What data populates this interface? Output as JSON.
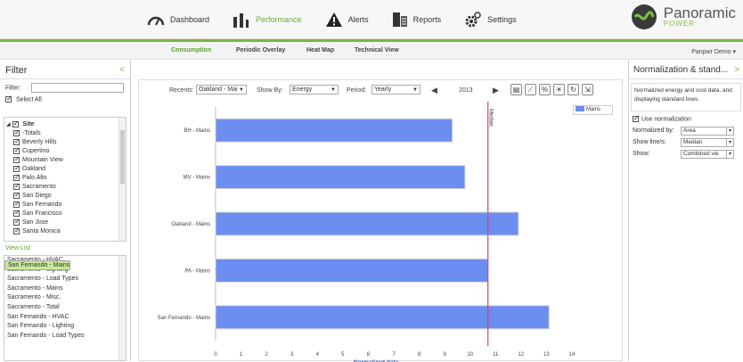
{
  "nav": {
    "items": [
      {
        "label": "Dashboard",
        "icon": "gauge-icon"
      },
      {
        "label": "Performance",
        "icon": "bars-icon",
        "active": true
      },
      {
        "label": "Alerts",
        "icon": "warning-icon"
      },
      {
        "label": "Reports",
        "icon": "reports-icon"
      },
      {
        "label": "Settings",
        "icon": "gear-icon"
      }
    ],
    "brand": "Panoramic",
    "brand_sub": "POWER"
  },
  "subnav": {
    "tabs": [
      "Consumption",
      "Periodic Overlay",
      "Heat Map",
      "Technical View"
    ],
    "user": "Panpwr Demo ▾"
  },
  "filter": {
    "title": "Filter",
    "collapse": "<",
    "filter_label": "Filter:",
    "select_all": "Select All",
    "root": "Site",
    "sites": [
      "-Totals",
      "Beverly Hills",
      "Cupertino",
      "Mountain View",
      "Oakland",
      "Palo Alto",
      "Sacramento",
      "San Diego",
      "San Fernando",
      "San Francisco",
      "San Jose",
      "Santa Monica"
    ],
    "view_list": "View List",
    "list": [
      "Sacramento - HVAC",
      "Sacramento - Lighting",
      "Sacramento - Load Types",
      "Sacramento - Mains",
      "Sacramento - Misc.",
      "Sacramento - Total",
      "San Fernando - HVAC",
      "San Fernando - Lighting",
      "San Fernando - Load Types",
      "San Fernando - Mains"
    ],
    "selected": "San Fernando - Mains"
  },
  "toolbar": {
    "recents_label": "Recents:",
    "recents_value": "Oakland - Mai",
    "showby_label": "Show By:",
    "showby_value": "Energy",
    "period_label": "Period:",
    "period_value": "Yearly",
    "year": "2013"
  },
  "chart_data": {
    "type": "bar",
    "orientation": "horizontal",
    "categories": [
      "BH - Mains",
      "MV - Mains",
      "Oakland - Mains",
      "PA - Mains",
      "San Fernando - Mains"
    ],
    "series": [
      {
        "name": "Mains",
        "values": [
          9.3,
          9.8,
          11.9,
          10.7,
          13.1
        ],
        "color": "#6c8ef0"
      }
    ],
    "xlabel": "Normalized data",
    "xlim": [
      0,
      14
    ],
    "xticks": [
      0,
      1,
      2,
      3,
      4,
      5,
      6,
      7,
      8,
      9,
      10,
      11,
      12,
      13,
      14
    ],
    "median": {
      "label": "Median",
      "value": 10.7,
      "color": "#e83e6c"
    },
    "legend": "top-right"
  },
  "norm": {
    "title": "Normalization & stand...",
    "expand": ">",
    "desc": "Normalized energy and cost data, and displaying standard lines.",
    "use_label": "Use normalization",
    "normalized_by_label": "Normalized by:",
    "normalized_by_value": "Area",
    "show_lines_label": "Show line/s:",
    "show_lines_value": "Median",
    "show_label": "Show:",
    "show_value": "Combined vie"
  },
  "colors": {
    "accent": "#7cb445",
    "bar": "#6c8ef0",
    "median": "#e83e6c"
  }
}
